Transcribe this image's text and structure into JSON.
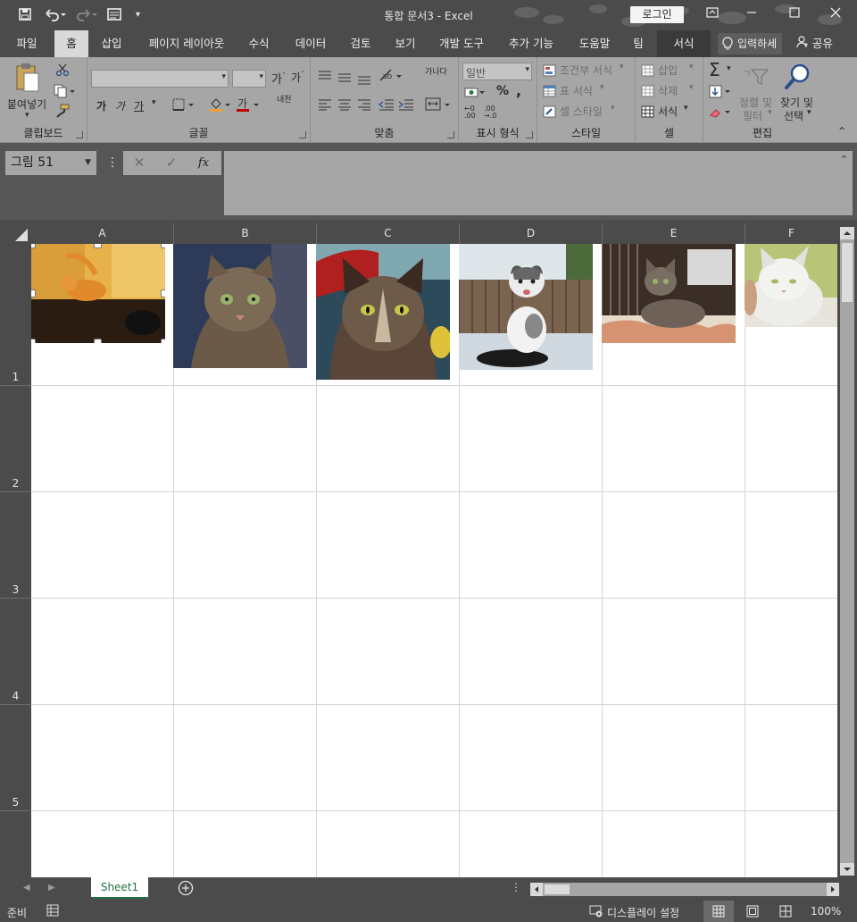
{
  "window": {
    "title": "통합 문서3  -  Excel",
    "login_label": "로그인"
  },
  "tabs": [
    {
      "label": "파일"
    },
    {
      "label": "홈"
    },
    {
      "label": "삽입"
    },
    {
      "label": "페이지 레이아웃"
    },
    {
      "label": "수식"
    },
    {
      "label": "데이터"
    },
    {
      "label": "검토"
    },
    {
      "label": "보기"
    },
    {
      "label": "개발 도구"
    },
    {
      "label": "추가 기능"
    },
    {
      "label": "도움말"
    },
    {
      "label": "팀"
    },
    {
      "label": "서식"
    }
  ],
  "tell_me": "입력하세",
  "share": "공유",
  "ribbon": {
    "clipboard": {
      "label": "클립보드",
      "paste": "붙여넣기"
    },
    "font": {
      "label": "글꼴",
      "bold": "가",
      "italic": "가",
      "underline": "가",
      "phonetic": "내천"
    },
    "alignment": {
      "label": "맞춤",
      "wrap": "가나다"
    },
    "number": {
      "label": "표시 형식",
      "format": "일반",
      "percent": "%"
    },
    "styles": {
      "label": "스타일",
      "conditional": "조건부 서식",
      "table": "표 서식",
      "cell": "셀 스타일"
    },
    "cells": {
      "label": "셀",
      "insert": "삽입",
      "delete": "삭제",
      "format": "서식"
    },
    "editing": {
      "label": "편집",
      "sort_line1": "정렬 및",
      "sort_line2": "필터",
      "find_line1": "찾기 및",
      "find_line2": "선택"
    }
  },
  "formula_bar": {
    "name_box": "그림 51",
    "fx": "fx",
    "formula": ""
  },
  "columns": [
    "A",
    "B",
    "C",
    "D",
    "E",
    "F"
  ],
  "rows": [
    "1",
    "2",
    "3",
    "4",
    "5"
  ],
  "sheet_tabs": [
    {
      "label": "Sheet1"
    }
  ],
  "status": {
    "ready": "준비",
    "display_settings": "디스플레이 설정",
    "zoom": "100%"
  },
  "colors": {
    "accent": "#217346",
    "dark_chrome": "#4b4b4b",
    "ribbon": "#a6a6a6"
  }
}
